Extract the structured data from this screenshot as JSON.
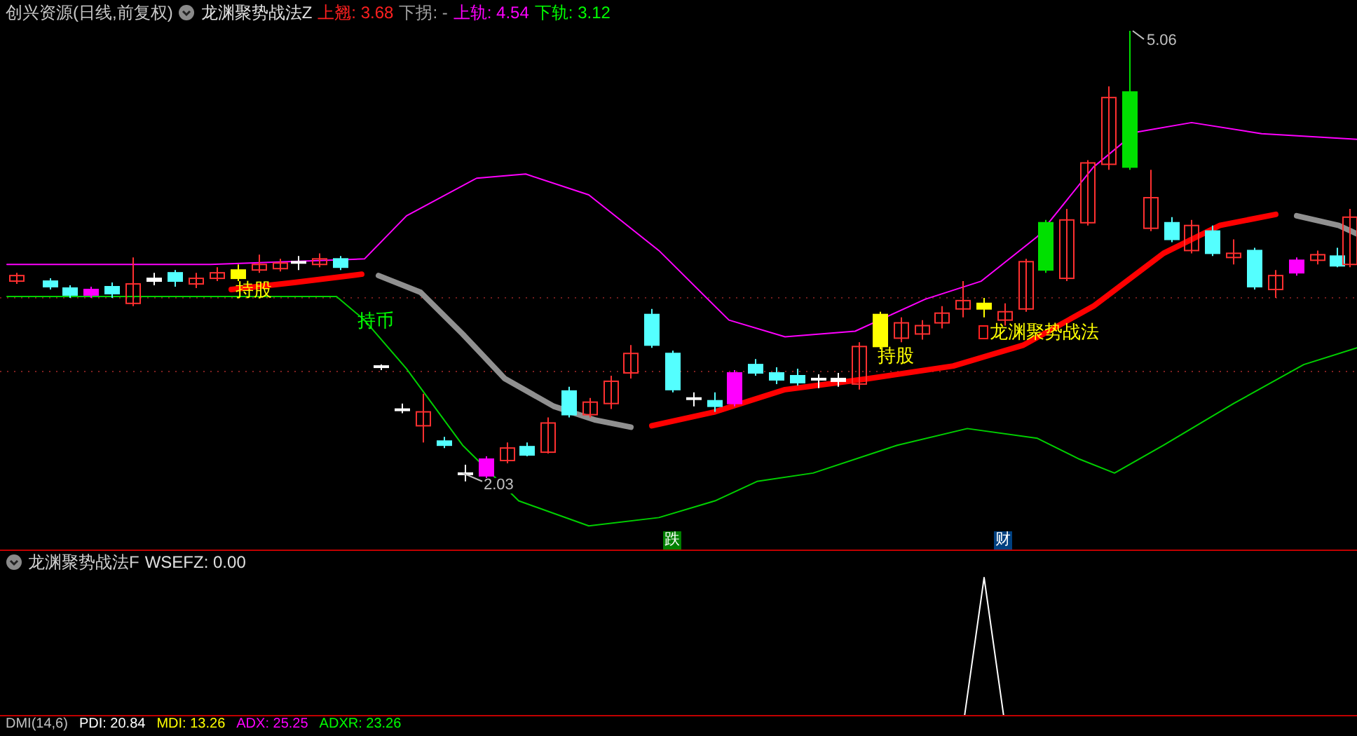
{
  "header": {
    "title": "创兴资源(日线,前复权)",
    "indicator": "龙渊聚势战法Z",
    "values": [
      {
        "label": "上翘:",
        "value": "3.68",
        "color": "#ff2020"
      },
      {
        "label": "下拐:",
        "value": "-",
        "color": "#a0a0a0"
      },
      {
        "label": "上轨:",
        "value": "4.54",
        "color": "#ff00ff"
      },
      {
        "label": "下轨:",
        "value": "3.12",
        "color": "#00ff00"
      }
    ]
  },
  "chart_labels": [
    {
      "kind": "signal",
      "text": "持股"
    },
    {
      "kind": "signal",
      "text": "持币"
    },
    {
      "kind": "signal",
      "text": "持股"
    },
    {
      "kind": "boxed",
      "text": "龙渊聚势战法"
    },
    {
      "kind": "price",
      "text": "5.06"
    },
    {
      "kind": "price",
      "text": "2.03"
    },
    {
      "kind": "badge",
      "text": "跌",
      "color": "#008000"
    },
    {
      "kind": "badge",
      "text": "财",
      "color": "#004080"
    }
  ],
  "sub_panel": {
    "title": "龙渊聚势战法F",
    "values": [
      {
        "label": "WSEFZ:",
        "value": "0.00"
      }
    ]
  },
  "bottom_panel": {
    "title": "DMI(14,6)",
    "values": [
      {
        "label": "PDI:",
        "value": "20.84",
        "color": "#ffffff"
      },
      {
        "label": "MDI:",
        "value": "13.26",
        "color": "#ffff00"
      },
      {
        "label": "ADX:",
        "value": "25.25",
        "color": "#ff00ff"
      },
      {
        "label": "ADXR:",
        "value": "23.26",
        "color": "#00ff00"
      }
    ]
  }
}
